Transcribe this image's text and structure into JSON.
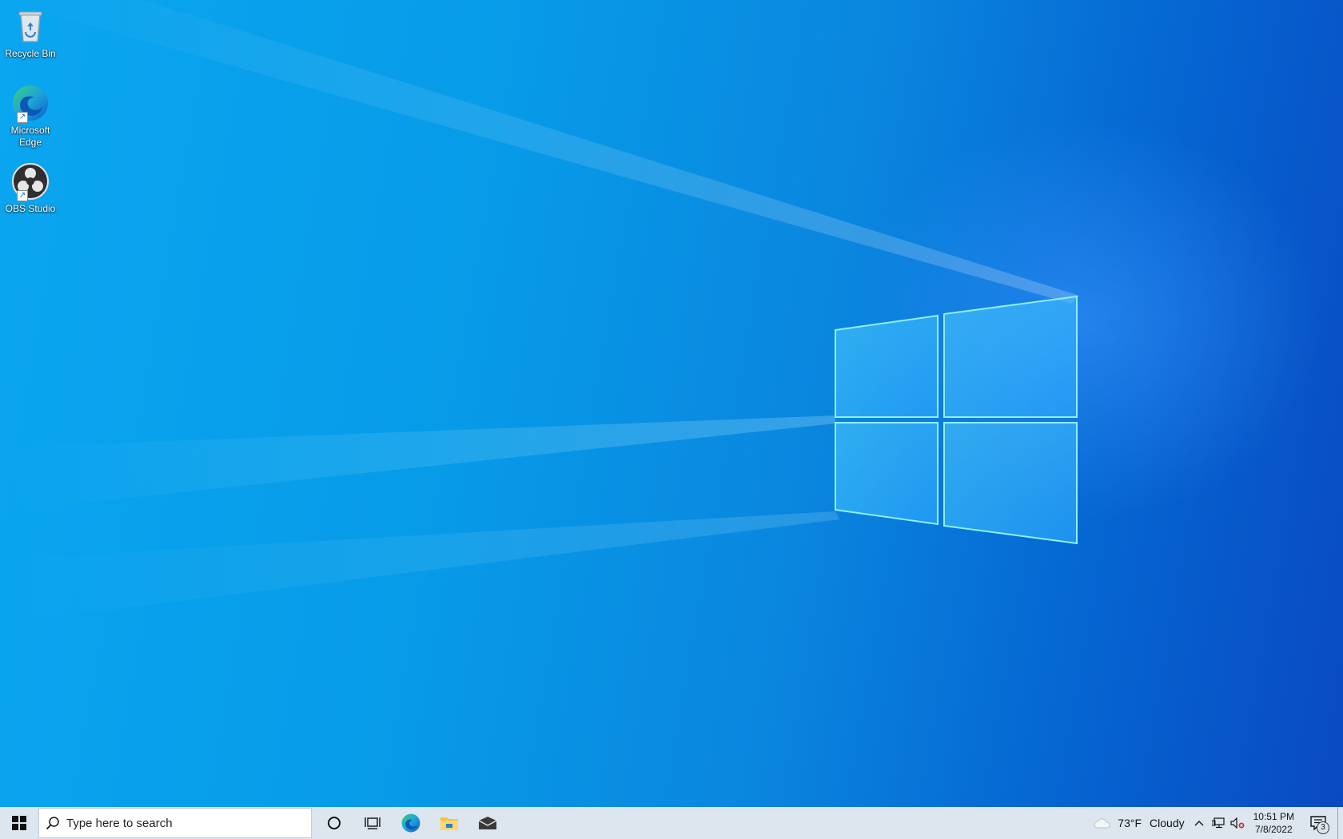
{
  "desktop": {
    "icons": [
      {
        "label": "Recycle Bin",
        "icon": "recycle-bin-icon"
      },
      {
        "label": "Microsoft Edge",
        "icon": "edge-icon"
      },
      {
        "label": "OBS Studio",
        "icon": "obs-icon"
      }
    ]
  },
  "taskbar": {
    "start_icon": "windows-logo-icon",
    "search_placeholder": "Type here to search",
    "pinned": [
      "cortana-icon",
      "task-view-icon",
      "edge-icon",
      "file-explorer-icon",
      "mail-icon"
    ],
    "weather": {
      "temp": "73°F",
      "condition": "Cloudy"
    },
    "clock": {
      "time": "10:51 PM",
      "date": "7/8/2022"
    },
    "notification_count": "3"
  }
}
